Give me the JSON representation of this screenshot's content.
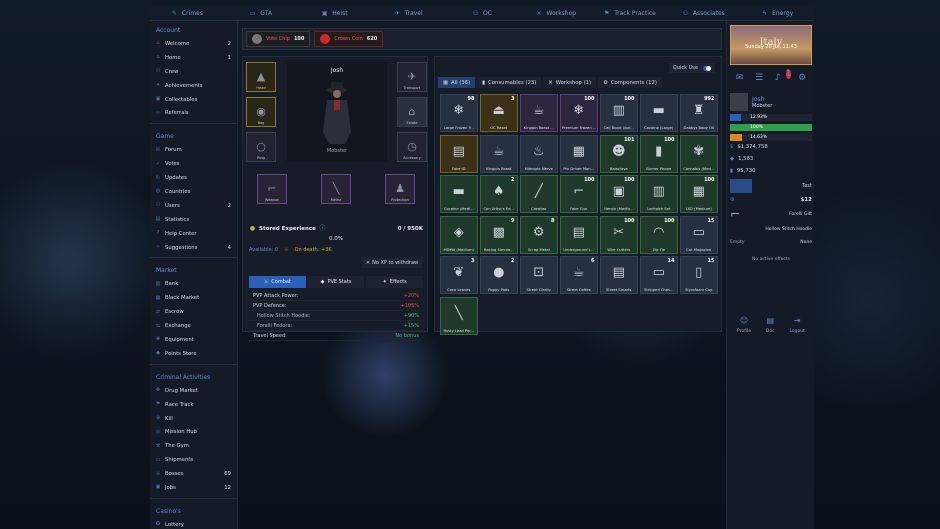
{
  "topnav": [
    {
      "label": "Crimes",
      "icon": "crimes-icon",
      "glyph": "✎"
    },
    {
      "label": "GTA",
      "icon": "car-icon",
      "glyph": "▭"
    },
    {
      "label": "Heist",
      "icon": "heist-icon",
      "glyph": "▣"
    },
    {
      "label": "Travel",
      "icon": "plane-icon",
      "glyph": "✈"
    },
    {
      "label": "OC",
      "icon": "group-icon",
      "glyph": "⚇"
    },
    {
      "label": "Workshop",
      "icon": "tools-icon",
      "glyph": "✕"
    },
    {
      "label": "Track Practice",
      "icon": "flag-icon",
      "glyph": "⚑"
    },
    {
      "label": "Associates",
      "icon": "users-icon",
      "glyph": "⚇"
    },
    {
      "label": "Energy",
      "icon": "bolt-icon",
      "glyph": "ϟ"
    }
  ],
  "sidebar": {
    "sections": [
      {
        "title": "Account",
        "items": [
          {
            "label": "Welcome",
            "count": "2",
            "icon": "home-icon",
            "glyph": "⌂"
          },
          {
            "label": "Home",
            "count": "1",
            "icon": "house-icon",
            "glyph": "⌂"
          },
          {
            "label": "Crew",
            "count": "",
            "icon": "crew-icon",
            "glyph": "⚇"
          },
          {
            "label": "Achievements",
            "count": "",
            "icon": "trophy-icon",
            "glyph": "✦"
          },
          {
            "label": "Collectables",
            "count": "",
            "icon": "box-icon",
            "glyph": "▣"
          },
          {
            "label": "Referrals",
            "count": "",
            "icon": "link-icon",
            "glyph": "∞"
          }
        ]
      },
      {
        "title": "Game",
        "items": [
          {
            "label": "Forum",
            "count": "",
            "icon": "chat-icon",
            "glyph": "✉"
          },
          {
            "label": "Votes",
            "count": "",
            "icon": "vote-icon",
            "glyph": "✓"
          },
          {
            "label": "Updates",
            "count": "",
            "icon": "updates-icon",
            "glyph": "↻"
          },
          {
            "label": "Countries",
            "count": "",
            "icon": "globe-icon",
            "glyph": "◍"
          },
          {
            "label": "Users",
            "count": "2",
            "icon": "users-icon",
            "glyph": "⚇"
          },
          {
            "label": "Statistics",
            "count": "",
            "icon": "stats-icon",
            "glyph": "▤"
          },
          {
            "label": "Help Center",
            "count": "",
            "icon": "help-icon",
            "glyph": "?"
          },
          {
            "label": "Suggestions",
            "count": "4",
            "icon": "idea-icon",
            "glyph": "✧"
          }
        ]
      },
      {
        "title": "Market",
        "items": [
          {
            "label": "Bank",
            "count": "",
            "icon": "bank-icon",
            "glyph": "▥"
          },
          {
            "label": "Black Market",
            "count": "",
            "icon": "market-icon",
            "glyph": "▦"
          },
          {
            "label": "Escrow",
            "count": "",
            "icon": "escrow-icon",
            "glyph": "⇄"
          },
          {
            "label": "Exchange",
            "count": "",
            "icon": "exchange-icon",
            "glyph": "⇆"
          },
          {
            "label": "Equipment",
            "count": "",
            "icon": "equipment-icon",
            "glyph": "✚"
          },
          {
            "label": "Points Store",
            "count": "",
            "icon": "store-icon",
            "glyph": "◆"
          }
        ]
      },
      {
        "title": "Criminal Activities",
        "items": [
          {
            "label": "Drug Market",
            "count": "",
            "icon": "drug-icon",
            "glyph": "✤"
          },
          {
            "label": "Race Track",
            "count": "",
            "icon": "race-icon",
            "glyph": "⚑"
          },
          {
            "label": "Kill",
            "count": "",
            "icon": "target-icon",
            "glyph": "⊕"
          },
          {
            "label": "Mission Hub",
            "count": "",
            "icon": "mission-icon",
            "glyph": "◎"
          },
          {
            "label": "The Gym",
            "count": "",
            "icon": "gym-icon",
            "glyph": "⚒"
          },
          {
            "label": "Shipments",
            "count": "",
            "icon": "ship-icon",
            "glyph": "▭"
          },
          {
            "label": "Bosses",
            "count": "69",
            "icon": "boss-icon",
            "glyph": "☠"
          },
          {
            "label": "Jobs",
            "count": "12",
            "icon": "jobs-icon",
            "glyph": "▣"
          }
        ]
      },
      {
        "title": "Casino's",
        "items": [
          {
            "label": "Lottery",
            "count": "",
            "icon": "lottery-icon",
            "glyph": "✪"
          },
          {
            "label": "Roulette",
            "count": "",
            "icon": "roulette-icon",
            "glyph": "◉"
          }
        ]
      }
    ]
  },
  "currency": [
    {
      "label": "Vote Chip",
      "value": "100",
      "color": "#777777"
    },
    {
      "label": "Crown Coin",
      "value": "620",
      "color": "#d02828"
    }
  ],
  "character": {
    "name": "Josh",
    "rank": "Mobster",
    "slots": {
      "head": "Head",
      "bag": "Bag",
      "ring": "Ring",
      "transport": "Transport",
      "estate": "Estate",
      "accessory": "Accessory",
      "weapon": "Weapon",
      "melee": "Melee",
      "protection": "Protection"
    },
    "stored_xp_label": "Stored Experience",
    "stored_xp": "0 / 950K",
    "xp_percent": "0.0%",
    "available": "Available: 0",
    "on_death": "On death: +3K",
    "no_xp": "No XP to withdraw",
    "tabs": [
      "Combat",
      "PVE Stats",
      "Effects"
    ],
    "stats": [
      {
        "label": "PVP Attack Power:",
        "value": "+20%",
        "color": "#e05050",
        "indent": false
      },
      {
        "label": "PVP Defence:",
        "value": "+105%",
        "color": "#e05050",
        "indent": false
      },
      {
        "label": "Hollow Stitch Hoodie:",
        "value": "+90%",
        "color": "#4fc060",
        "indent": true
      },
      {
        "label": "Forelli Fedora:",
        "value": "+15%",
        "color": "#4fc060",
        "indent": true
      },
      {
        "label": "Travel Speed:",
        "value": "No bonus",
        "color": "#4fc060",
        "indent": false
      }
    ]
  },
  "inventory": {
    "quick_use": "Quick Use",
    "tabs": [
      "All (36)",
      "Consumables (23)",
      "Workshop (1)",
      "Components (12)"
    ],
    "items": [
      {
        "name": "Large Frozen P...",
        "qty": "98",
        "tier": "",
        "glyph": "❄"
      },
      {
        "name": "OC Reset",
        "qty": "3",
        "tier": "gold",
        "glyph": "⏏"
      },
      {
        "name": "Kingpin Roast ...",
        "qty": "",
        "tier": "purple",
        "glyph": "☕"
      },
      {
        "name": "Premium Frozen ...",
        "qty": "100",
        "tier": "purple",
        "glyph": "❄"
      },
      {
        "name": "Cell Block Upri...",
        "qty": "100",
        "tier": "",
        "glyph": "▥"
      },
      {
        "name": "Cocaine (Large)",
        "qty": "",
        "tier": "",
        "glyph": "▬"
      },
      {
        "name": "Dabbys Baby Oil",
        "qty": "992",
        "tier": "",
        "glyph": "♜"
      },
      {
        "name": "Fake ID",
        "qty": "",
        "tier": "gold",
        "glyph": "▤"
      },
      {
        "name": "Kingpin Roast",
        "qty": "",
        "tier": "",
        "glyph": "☕"
      },
      {
        "name": "Midnight Nerve",
        "qty": "",
        "tier": "",
        "glyph": "♨"
      },
      {
        "name": "Pro Driver Man...",
        "qty": "",
        "tier": "",
        "glyph": "▦"
      },
      {
        "name": "Balaclava",
        "qty": "101",
        "tier": "green",
        "glyph": "☻"
      },
      {
        "name": "Burner Phone",
        "qty": "100",
        "tier": "green",
        "glyph": "▮"
      },
      {
        "name": "Cannabis (Med...",
        "qty": "",
        "tier": "green",
        "glyph": "✾"
      },
      {
        "name": "Cocaine (Medi...",
        "qty": "",
        "tier": "green",
        "glyph": "▬"
      },
      {
        "name": "Con Artist's Ed...",
        "qty": "2",
        "tier": "green",
        "glyph": "♠"
      },
      {
        "name": "Crowbar",
        "qty": "",
        "tier": "green",
        "glyph": "╱"
      },
      {
        "name": "Fake Gun",
        "qty": "100",
        "tier": "green",
        "glyph": "⌐"
      },
      {
        "name": "Heroin (Mediu...",
        "qty": "100",
        "tier": "green",
        "glyph": "▣"
      },
      {
        "name": "Lockpick Set",
        "qty": "",
        "tier": "green",
        "glyph": "▥"
      },
      {
        "name": "LSD (Medium)",
        "qty": "100",
        "tier": "green",
        "glyph": "▦"
      },
      {
        "name": "MDMA (Medium)",
        "qty": "",
        "tier": "green",
        "glyph": "◈"
      },
      {
        "name": "Racing Simula...",
        "qty": "9",
        "tier": "green",
        "glyph": "▩"
      },
      {
        "name": "Scrap Metal",
        "qty": "8",
        "tier": "green",
        "glyph": "⚙"
      },
      {
        "name": "Underground L...",
        "qty": "",
        "tier": "green",
        "glyph": "▤"
      },
      {
        "name": "Wire Cutters",
        "qty": "100",
        "tier": "green",
        "glyph": "✂"
      },
      {
        "name": "Zip Tie",
        "qty": "100",
        "tier": "green",
        "glyph": "◠"
      },
      {
        "name": "Car Magazine",
        "qty": "15",
        "tier": "",
        "glyph": "▭"
      },
      {
        "name": "Coca Leaves",
        "qty": "3",
        "tier": "",
        "glyph": "❦"
      },
      {
        "name": "Poppy Pods",
        "qty": "2",
        "tier": "",
        "glyph": "●"
      },
      {
        "name": "Street Clarity",
        "qty": "",
        "tier": "",
        "glyph": "⊡"
      },
      {
        "name": "Street Coffee",
        "qty": "6",
        "tier": "",
        "glyph": "☕"
      },
      {
        "name": "Street Smarts",
        "qty": "",
        "tier": "",
        "glyph": "▤"
      },
      {
        "name": "Stripped Chas...",
        "qty": "14",
        "tier": "",
        "glyph": "▭"
      },
      {
        "name": "Styrofoam Cup",
        "qty": "15",
        "tier": "",
        "glyph": "▯"
      },
      {
        "name": "Rusty Lead Pip...",
        "qty": "",
        "tier": "green",
        "glyph": "╲"
      }
    ]
  },
  "right": {
    "banner_title": "Italy",
    "banner_date": "Sunday 20 Jul, 11:43",
    "notif_count": "1",
    "name": "Josh",
    "rank": "Mobster",
    "bars": [
      {
        "label": "12.93%",
        "color": "#2d5fb8",
        "fill": 0.1293
      },
      {
        "label": "100%",
        "color": "#2fa04a",
        "fill": 1.0
      },
      {
        "label": "14.63%",
        "color": "#d98a1a",
        "fill": 0.1463
      }
    ],
    "money": "$1,374,758",
    "points": "1,583",
    "bullets": "95,730",
    "test": "Test",
    "price": "$12",
    "forelli": "Forelli Gift",
    "hoodie": "Hollow Stitch Hoodie",
    "empty": "Empty",
    "none": "None",
    "no_effects": "No active effects",
    "nav": [
      {
        "label": "Profile",
        "icon": "profile-icon",
        "glyph": "☺"
      },
      {
        "label": "Doc",
        "icon": "doc-icon",
        "glyph": "▤"
      },
      {
        "label": "Logout",
        "icon": "logout-icon",
        "glyph": "⇥"
      }
    ]
  },
  "colors": {
    "accent": "#2c5fb8",
    "bg": "#141b27"
  }
}
